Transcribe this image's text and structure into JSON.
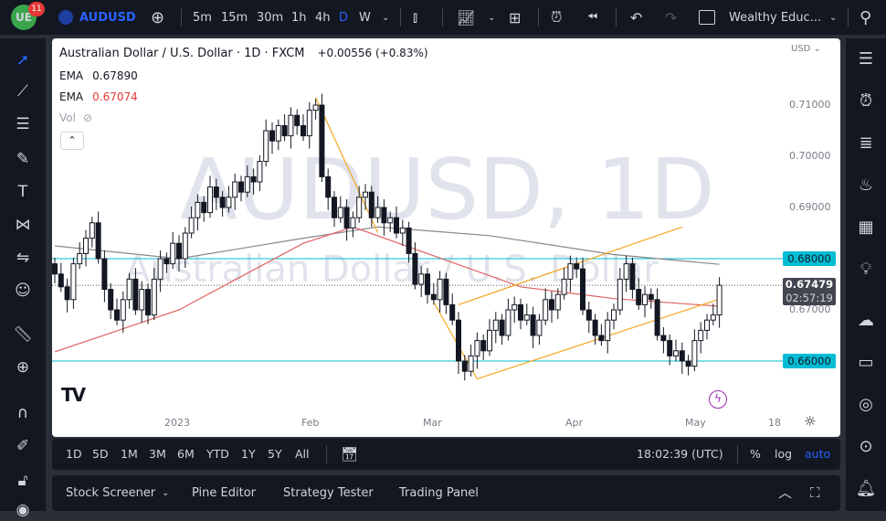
{
  "topbar": {
    "notifications": "11",
    "logo_text": "UE",
    "symbol": "AUDUSD",
    "intervals": [
      "5m",
      "15m",
      "30m",
      "1h",
      "4h",
      "D",
      "W"
    ],
    "active_interval": "D",
    "layout_name": "Wealthy Educ...",
    "accent": "#2962ff"
  },
  "legend": {
    "title": "Australian Dollar / U.S. Dollar · 1D · FXCM",
    "change": "+0.00556 (+0.83%)",
    "ema1_label": "EMA",
    "ema1_value": "0.67890",
    "ema2_label": "EMA",
    "ema2_value": "0.67074",
    "vol_label": "Vol"
  },
  "watermark": {
    "line1": "AUDUSD, 1D",
    "line2": "Australian Dollar / U.S. Dollar"
  },
  "price_axis": {
    "currency": "USD",
    "ticks": [
      "0.71000",
      "0.70000",
      "0.69000",
      "0.67000"
    ],
    "level_high": "0.68000",
    "level_low": "0.66000",
    "last_price": "0.67479",
    "countdown": "02:57:19"
  },
  "time_axis": [
    "2023",
    "Feb",
    "Mar",
    "Apr",
    "May",
    "18"
  ],
  "bottom_bar": {
    "ranges": [
      "1D",
      "5D",
      "1M",
      "3M",
      "6M",
      "YTD",
      "1Y",
      "5Y",
      "All"
    ],
    "clock": "18:02:39 (UTC)",
    "percent": "%",
    "log": "log",
    "auto": "auto"
  },
  "bottom_panel": {
    "tabs": [
      "Stock Screener",
      "Pine Editor",
      "Strategy Tester",
      "Trading Panel"
    ]
  },
  "chart_data": {
    "type": "candlestick",
    "symbol": "AUDUSD",
    "interval": "1D",
    "ylim": [
      0.654,
      0.718
    ],
    "closes": [
      0.677,
      0.6745,
      0.672,
      0.679,
      0.681,
      0.684,
      0.687,
      0.68,
      0.674,
      0.67,
      0.668,
      0.672,
      0.676,
      0.67,
      0.674,
      0.669,
      0.676,
      0.68,
      0.679,
      0.683,
      0.68,
      0.685,
      0.688,
      0.691,
      0.689,
      0.694,
      0.692,
      0.69,
      0.692,
      0.695,
      0.693,
      0.696,
      0.695,
      0.699,
      0.705,
      0.703,
      0.706,
      0.704,
      0.708,
      0.706,
      0.704,
      0.709,
      0.71,
      0.696,
      0.692,
      0.688,
      0.69,
      0.686,
      0.688,
      0.692,
      0.693,
      0.688,
      0.69,
      0.687,
      0.688,
      0.685,
      0.686,
      0.681,
      0.675,
      0.677,
      0.673,
      0.672,
      0.676,
      0.671,
      0.668,
      0.66,
      0.658,
      0.661,
      0.664,
      0.662,
      0.666,
      0.668,
      0.665,
      0.67,
      0.671,
      0.668,
      0.669,
      0.665,
      0.668,
      0.672,
      0.67,
      0.673,
      0.676,
      0.679,
      0.678,
      0.67,
      0.668,
      0.665,
      0.664,
      0.668,
      0.67,
      0.676,
      0.679,
      0.674,
      0.671,
      0.673,
      0.672,
      0.665,
      0.664,
      0.661,
      0.662,
      0.66,
      0.659,
      0.664,
      0.666,
      0.668,
      0.669,
      0.6748
    ],
    "ema_fast": [
      [
        0,
        0.6618
      ],
      [
        20,
        0.67
      ],
      [
        40,
        0.683
      ],
      [
        48,
        0.6862
      ],
      [
        60,
        0.681
      ],
      [
        75,
        0.6745
      ],
      [
        90,
        0.6722
      ],
      [
        107,
        0.6707
      ]
    ],
    "ema_slow": [
      [
        0,
        0.6825
      ],
      [
        20,
        0.68
      ],
      [
        40,
        0.684
      ],
      [
        52,
        0.6862
      ],
      [
        70,
        0.6845
      ],
      [
        90,
        0.6808
      ],
      [
        107,
        0.6789
      ]
    ],
    "trendlines": [
      [
        [
          42,
          0.7115
        ],
        [
          52,
          0.6851
        ]
      ],
      [
        [
          61,
          0.6715
        ],
        [
          68,
          0.6565
        ]
      ],
      [
        [
          68,
          0.6565
        ],
        [
          107,
          0.6721
        ]
      ],
      [
        [
          65,
          0.671
        ],
        [
          101,
          0.6862
        ]
      ]
    ],
    "levels": [
      0.68,
      0.66
    ],
    "last": 0.67479
  }
}
